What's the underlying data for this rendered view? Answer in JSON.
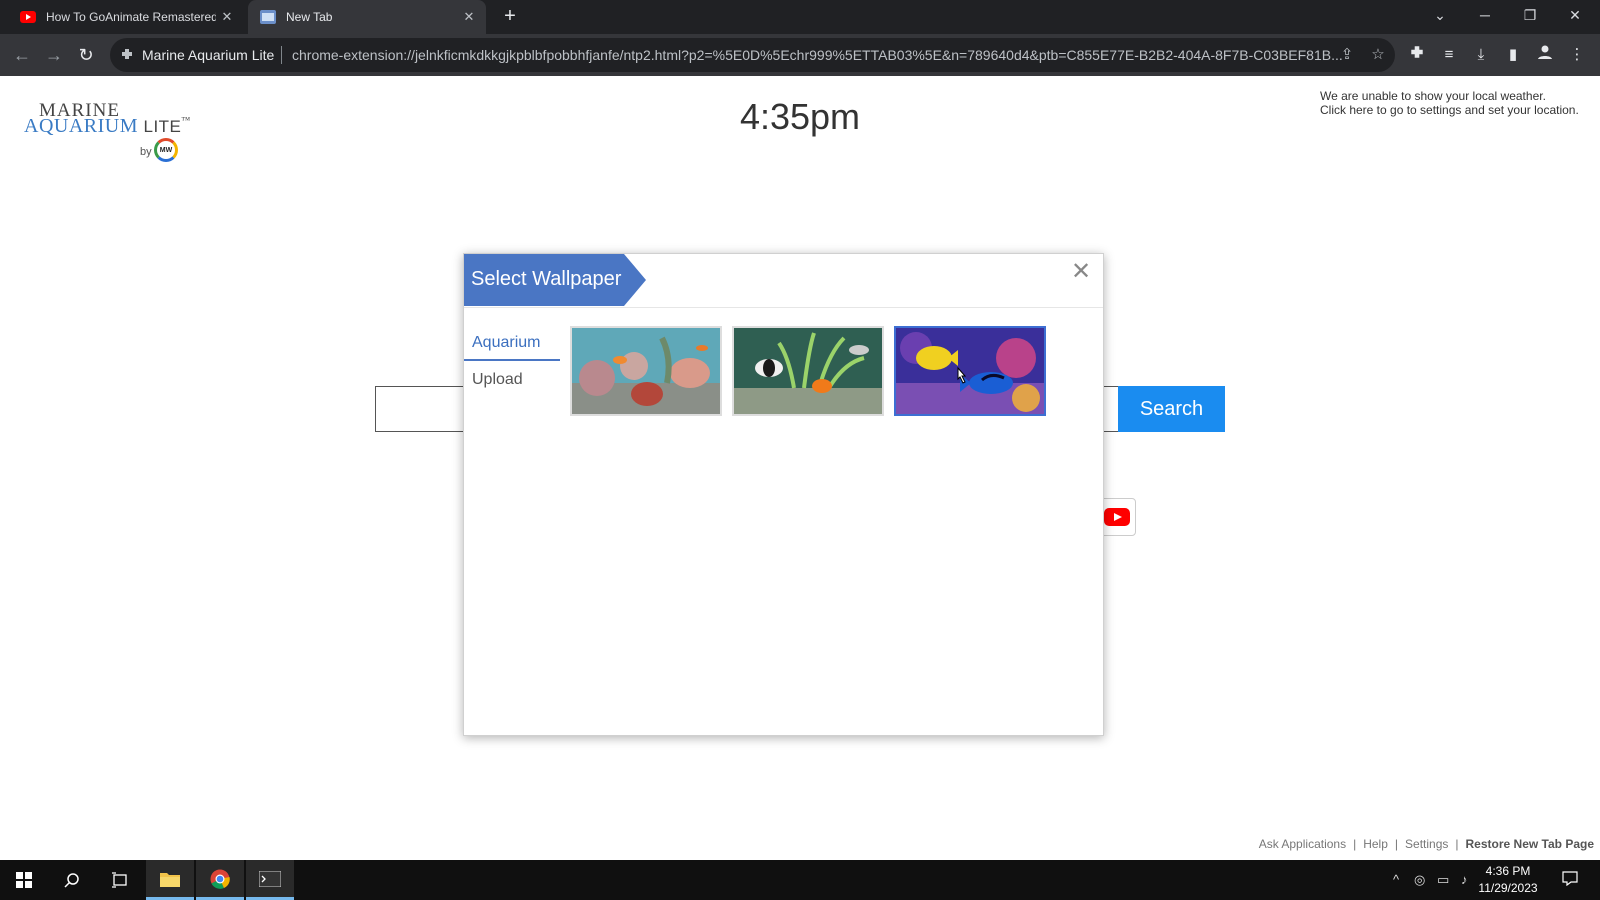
{
  "browser": {
    "tabs": [
      {
        "title": "How To GoAnimate Remastered",
        "close": "✕"
      },
      {
        "title": "New Tab",
        "close": "✕"
      }
    ],
    "new_tab": "+",
    "omnibox": {
      "site_name": "Marine Aquarium Lite",
      "url": "chrome-extension://jelnkficmkdkkgjkpblbfpobbhfjanfe/ntp2.html?p2=%5E0D%5Echr999%5ETTAB03%5E&n=789640d4&ptb=C855E77E-B2B2-404A-8F7B-C03BEF81B..."
    }
  },
  "page": {
    "logo": {
      "line1": "MARINE",
      "line2": "AQUARIUM",
      "line3": "LITE",
      "tm": "™",
      "by": "by",
      "badge": "MW"
    },
    "time": "4:35pm",
    "weather": {
      "line1": "We are unable to show your local weather.",
      "line2": "Click here to go to settings and set your location."
    },
    "search": {
      "placeholder": "",
      "button": "Search"
    },
    "footer": {
      "links": [
        "Ask Applications",
        "Help",
        "Settings"
      ],
      "restore": "Restore New Tab Page",
      "separator": "|"
    }
  },
  "modal": {
    "title": "Select Wallpaper",
    "close": "✕",
    "tabs": [
      {
        "label": "Aquarium",
        "active": true
      },
      {
        "label": "Upload",
        "active": false
      }
    ],
    "selected_index": 2
  },
  "taskbar": {
    "time": "4:36 PM",
    "date": "11/29/2023"
  },
  "colors": {
    "accent": "#1a8cf0",
    "modal_header": "#4a76c4",
    "chrome_dark": "#202124"
  }
}
